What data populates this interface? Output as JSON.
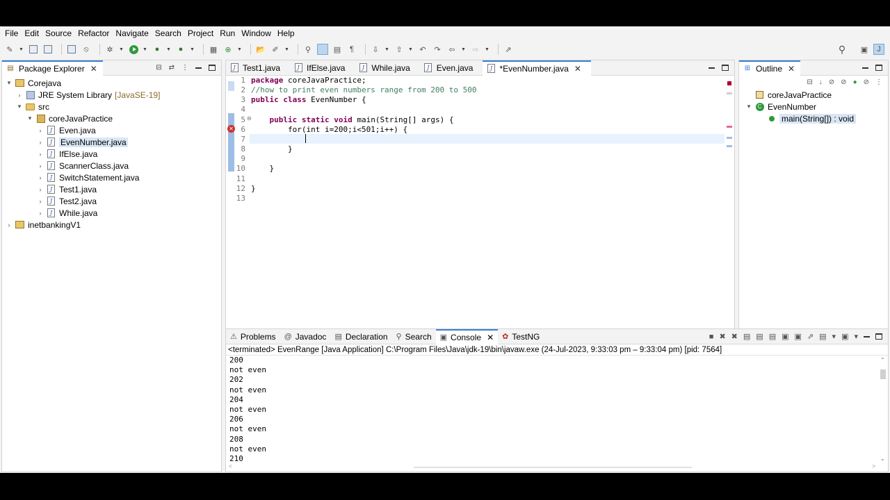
{
  "menu": [
    "File",
    "Edit",
    "Source",
    "Refactor",
    "Navigate",
    "Search",
    "Project",
    "Run",
    "Window",
    "Help"
  ],
  "package_explorer": {
    "title": "Package Explorer",
    "items": [
      {
        "label": "Corejava",
        "suffix": "",
        "level": 0,
        "twisty": "v",
        "icon": "project-icon",
        "selected": false
      },
      {
        "label": "JRE System Library",
        "suffix": "[JavaSE-19]",
        "level": 1,
        "twisty": ">",
        "icon": "library-icon",
        "selected": false
      },
      {
        "label": "src",
        "suffix": "",
        "level": 1,
        "twisty": "v",
        "icon": "source-folder-icon",
        "selected": false
      },
      {
        "label": "coreJavaPractice",
        "suffix": "",
        "level": 2,
        "twisty": "v",
        "icon": "package-icon",
        "selected": false
      },
      {
        "label": "Even.java",
        "suffix": "",
        "level": 3,
        "twisty": ">",
        "icon": "java-file-icon",
        "selected": false
      },
      {
        "label": "EvenNumber.java",
        "suffix": "",
        "level": 3,
        "twisty": ">",
        "icon": "java-file-icon",
        "selected": true
      },
      {
        "label": "IfElse.java",
        "suffix": "",
        "level": 3,
        "twisty": ">",
        "icon": "java-file-icon",
        "selected": false
      },
      {
        "label": "ScannerClass.java",
        "suffix": "",
        "level": 3,
        "twisty": ">",
        "icon": "java-file-icon",
        "selected": false
      },
      {
        "label": "SwitchStatement.java",
        "suffix": "",
        "level": 3,
        "twisty": ">",
        "icon": "java-file-icon",
        "selected": false
      },
      {
        "label": "Test1.java",
        "suffix": "",
        "level": 3,
        "twisty": ">",
        "icon": "java-file-icon",
        "selected": false
      },
      {
        "label": "Test2.java",
        "suffix": "",
        "level": 3,
        "twisty": ">",
        "icon": "java-file-icon",
        "selected": false
      },
      {
        "label": "While.java",
        "suffix": "",
        "level": 3,
        "twisty": ">",
        "icon": "java-file-icon",
        "selected": false
      },
      {
        "label": "inetbankingV1",
        "suffix": "",
        "level": 0,
        "twisty": ">",
        "icon": "project-icon",
        "selected": false
      }
    ]
  },
  "editor": {
    "tabs": [
      {
        "label": "Test1.java",
        "active": false
      },
      {
        "label": "IfElse.java",
        "active": false
      },
      {
        "label": "While.java",
        "active": false
      },
      {
        "label": "Even.java",
        "active": false
      },
      {
        "label": "*EvenNumber.java",
        "active": true
      }
    ],
    "lines": [
      {
        "n": "1",
        "html": "<span class='kw'>package</span> coreJavaPractice;"
      },
      {
        "n": "2",
        "html": "<span class='cm'>//how to print even numbers range from 200 to 500</span>"
      },
      {
        "n": "3",
        "html": "<span class='kw'>public</span> <span class='kw'>class</span> EvenNumber {"
      },
      {
        "n": "4",
        "html": ""
      },
      {
        "n": "5",
        "html": "    <span class='kw'>public</span> <span class='kw'>static</span> <span class='kw'>void</span> main(String[] args) {"
      },
      {
        "n": "6",
        "html": "        for(int i=200;i&lt;501;i++) {"
      },
      {
        "n": "7",
        "html": "            "
      },
      {
        "n": "8",
        "html": "        }"
      },
      {
        "n": "9",
        "html": ""
      },
      {
        "n": "10",
        "html": "    }"
      },
      {
        "n": "11",
        "html": ""
      },
      {
        "n": "12",
        "html": "}"
      },
      {
        "n": "13",
        "html": ""
      }
    ]
  },
  "outline": {
    "title": "Outline",
    "items": [
      {
        "label": "coreJavaPractice",
        "level": 0,
        "icon": "package-decl-icon"
      },
      {
        "label": "EvenNumber",
        "level": 0,
        "icon": "class-icon"
      },
      {
        "label": "main(String[]) : void",
        "level": 1,
        "icon": "method-icon"
      }
    ]
  },
  "bottom": {
    "tabs": [
      {
        "label": "Problems",
        "icon": "problems-icon",
        "active": false
      },
      {
        "label": "Javadoc",
        "icon": "at-icon",
        "active": false
      },
      {
        "label": "Declaration",
        "icon": "declaration-icon",
        "active": false
      },
      {
        "label": "Search",
        "icon": "search-icon",
        "active": false
      },
      {
        "label": "Console",
        "icon": "console-icon",
        "active": true
      },
      {
        "label": "TestNG",
        "icon": "testng-icon",
        "active": false
      }
    ],
    "console_title": "<terminated> EvenRange [Java Application] C:\\Program Files\\Java\\jdk-19\\bin\\javaw.exe  (24-Jul-2023, 9:33:03 pm – 9:33:04 pm) [pid: 7564]",
    "output": [
      "200",
      "not even",
      "202",
      "not even",
      "204",
      "not even",
      "206",
      "not even",
      "208",
      "not even",
      "210"
    ]
  }
}
